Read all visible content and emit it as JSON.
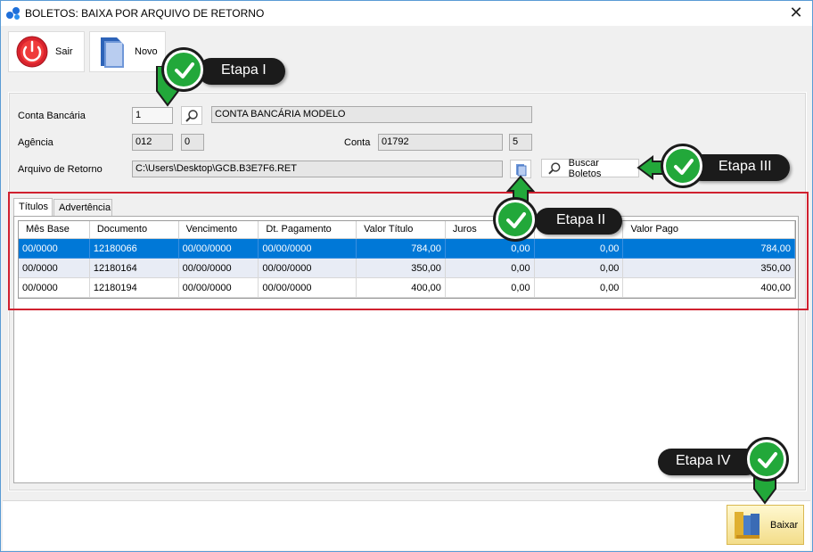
{
  "window": {
    "title": "BOLETOS: BAIXA POR ARQUIVO DE RETORNO",
    "close_glyph": "✕"
  },
  "toolbar": {
    "sair_label": "Sair",
    "novo_label": "Novo"
  },
  "form": {
    "conta_bancaria_label": "Conta Bancária",
    "conta_bancaria_code": "1",
    "conta_bancaria_name": "CONTA BANCÁRIA MODELO",
    "agencia_label": "Agência",
    "agencia_value": "012",
    "agencia_digit": "0",
    "conta_label": "Conta",
    "conta_value": "01792",
    "conta_digit": "5",
    "arquivo_label": "Arquivo de Retorno",
    "arquivo_value": "C:\\Users\\Desktop\\GCB.B3E7F6.RET",
    "buscar_label": "Buscar Boletos"
  },
  "tabs": [
    {
      "label": "Títulos"
    },
    {
      "label": "Advertência"
    }
  ],
  "grid": {
    "columns": [
      "Mês Base",
      "Documento",
      "Vencimento",
      "Dt. Pagamento",
      "Valor Título",
      "Juros",
      "",
      "Valor Pago"
    ],
    "rows": [
      [
        "00/0000",
        "12180066",
        "00/00/0000",
        "00/00/0000",
        "784,00",
        "0,00",
        "0,00",
        "784,00"
      ],
      [
        "00/0000",
        "12180164",
        "00/00/0000",
        "00/00/0000",
        "350,00",
        "0,00",
        "0,00",
        "350,00"
      ],
      [
        "00/0000",
        "12180194",
        "00/00/0000",
        "00/00/0000",
        "400,00",
        "0,00",
        "0,00",
        "400,00"
      ]
    ]
  },
  "footer": {
    "baixar_label": "Baixar"
  },
  "etapas": {
    "etapa1": "Etapa I",
    "etapa2": "Etapa II",
    "etapa3": "Etapa III",
    "etapa4": "Etapa IV"
  },
  "colors": {
    "selection": "#0078d7",
    "annotation_green": "#22a83a",
    "highlight_red": "#d0212f"
  }
}
